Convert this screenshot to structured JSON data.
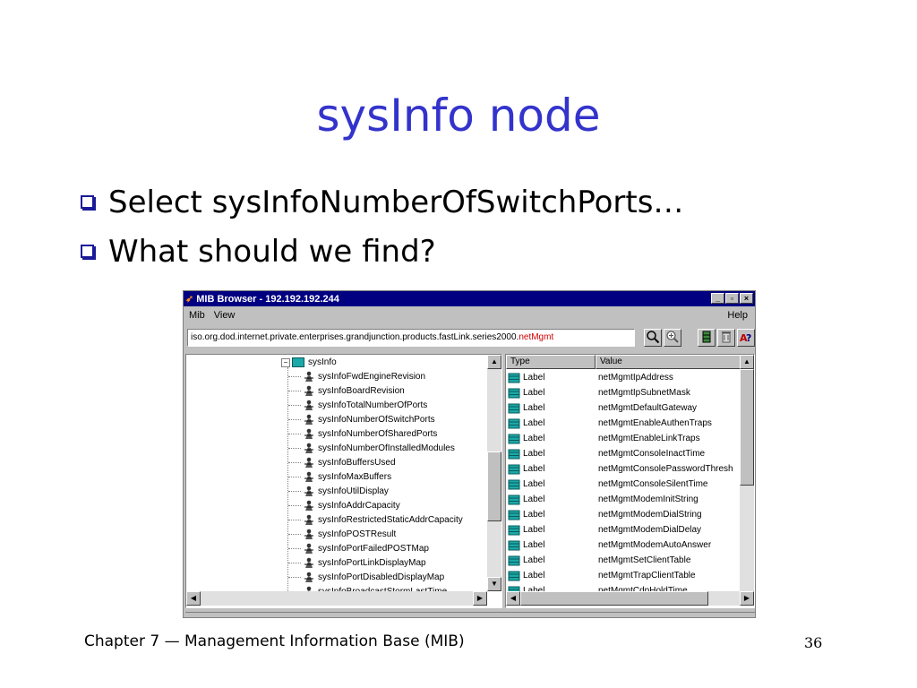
{
  "slide": {
    "title": "sysInfo node",
    "bullets": [
      "Select sysInfoNumberOfSwitchPorts…",
      "What should we find?"
    ],
    "footer_left": "Chapter 7 — Management Information Base (MIB)",
    "page_number": "36"
  },
  "window": {
    "title": "MIB Browser - 192.192.192.244",
    "controls": [
      "_",
      "▫",
      "×"
    ],
    "menu": [
      "Mib",
      "View"
    ],
    "help_menu": "Help",
    "address_prefix": "iso.org.dod.internet.private.enterprises.grandjunction.products.fastLink.series2000.",
    "address_highlight": "netMgmt",
    "toolbar_icons": [
      "search-icon",
      "zoom-icon",
      "grid-icon",
      "trash-icon",
      "help-icon"
    ],
    "colors": {
      "titlebar": "#000080",
      "highlight": "#d00000",
      "folder": "#1ba8a8",
      "slide_title": "#3333cc"
    }
  },
  "tree": {
    "root": "sysInfo",
    "items": [
      "sysInfoFwdEngineRevision",
      "sysInfoBoardRevision",
      "sysInfoTotalNumberOfPorts",
      "sysInfoNumberOfSwitchPorts",
      "sysInfoNumberOfSharedPorts",
      "sysInfoNumberOfInstalledModules",
      "sysInfoBuffersUsed",
      "sysInfoMaxBuffers",
      "sysInfoUtilDisplay",
      "sysInfoAddrCapacity",
      "sysInfoRestrictedStaticAddrCapacity",
      "sysInfoPOSTResult",
      "sysInfoPortFailedPOSTMap",
      "sysInfoPortLinkDisplayMap",
      "sysInfoPortDisabledDisplayMap",
      "sysInfoBroadcastStormLastTime"
    ]
  },
  "grid": {
    "headers": [
      "Type",
      "Value"
    ],
    "rows": [
      {
        "type": "Label",
        "value": "netMgmtIpAddress"
      },
      {
        "type": "Label",
        "value": "netMgmtIpSubnetMask"
      },
      {
        "type": "Label",
        "value": "netMgmtDefaultGateway"
      },
      {
        "type": "Label",
        "value": "netMgmtEnableAuthenTraps"
      },
      {
        "type": "Label",
        "value": "netMgmtEnableLinkTraps"
      },
      {
        "type": "Label",
        "value": "netMgmtConsoleInactTime"
      },
      {
        "type": "Label",
        "value": "netMgmtConsolePasswordThresh"
      },
      {
        "type": "Label",
        "value": "netMgmtConsoleSilentTime"
      },
      {
        "type": "Label",
        "value": "netMgmtModemInitString"
      },
      {
        "type": "Label",
        "value": "netMgmtModemDialString"
      },
      {
        "type": "Label",
        "value": "netMgmtModemDialDelay"
      },
      {
        "type": "Label",
        "value": "netMgmtModemAutoAnswer"
      },
      {
        "type": "Label",
        "value": "netMgmtSetClientTable"
      },
      {
        "type": "Label",
        "value": "netMgmtTrapClientTable"
      },
      {
        "type": "Label",
        "value": "netMgmtCdpHoldTime"
      }
    ]
  }
}
